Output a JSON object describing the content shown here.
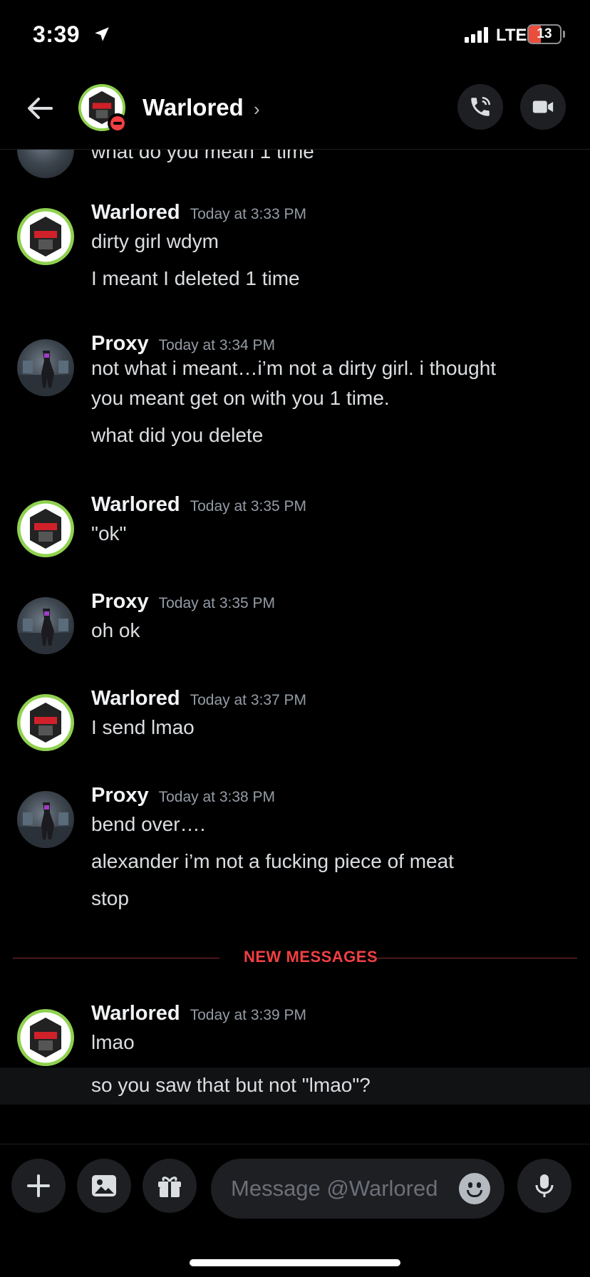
{
  "status_bar": {
    "time": "3:39",
    "network": "LTE",
    "battery": "13",
    "battery_level": 0.13
  },
  "header": {
    "contact_name": "Warlored",
    "chevron": "›",
    "icons": [
      "back-arrow-icon",
      "voice-call-icon",
      "video-call-icon"
    ]
  },
  "messages": {
    "partial_top": "what do you mean 1 time",
    "groups": [
      {
        "author": "Warlored",
        "time": "Today at 3:33 PM",
        "lines": [
          "dirty girl wdym",
          "I meant I deleted 1 time"
        ]
      },
      {
        "author": "Proxy",
        "time": "Today at 3:34 PM",
        "lines": [
          "not what i meant…i’m not a dirty girl. i thought",
          "you meant get on with you 1 time.",
          "what did you delete"
        ]
      },
      {
        "author": "Warlored",
        "time": "Today at 3:35 PM",
        "lines": [
          "\"ok\""
        ]
      },
      {
        "author": "Proxy",
        "time": "Today at 3:35 PM",
        "lines": [
          "oh ok"
        ]
      },
      {
        "author": "Warlored",
        "time": "Today at 3:37 PM",
        "lines": [
          "I send lmao"
        ]
      },
      {
        "author": "Proxy",
        "time": "Today at 3:38 PM",
        "lines": [
          "bend over….",
          "alexander i’m not a fucking piece of meat",
          "stop"
        ]
      },
      {
        "author": "Warlored",
        "time": "Today at 3:39 PM",
        "lines": [
          "lmao",
          "so you saw that but not \"lmao\"?"
        ]
      }
    ],
    "new_messages_label": "NEW MESSAGES"
  },
  "composer": {
    "placeholder": "Message @Warlored",
    "icons": [
      "plus-icon",
      "image-icon",
      "gift-icon",
      "emoji-icon",
      "microphone-icon"
    ]
  },
  "colors": {
    "background": "#000000",
    "accent_red": "#f23f43",
    "online_green": "#8fd14f",
    "timestamp": "#949ba4"
  }
}
